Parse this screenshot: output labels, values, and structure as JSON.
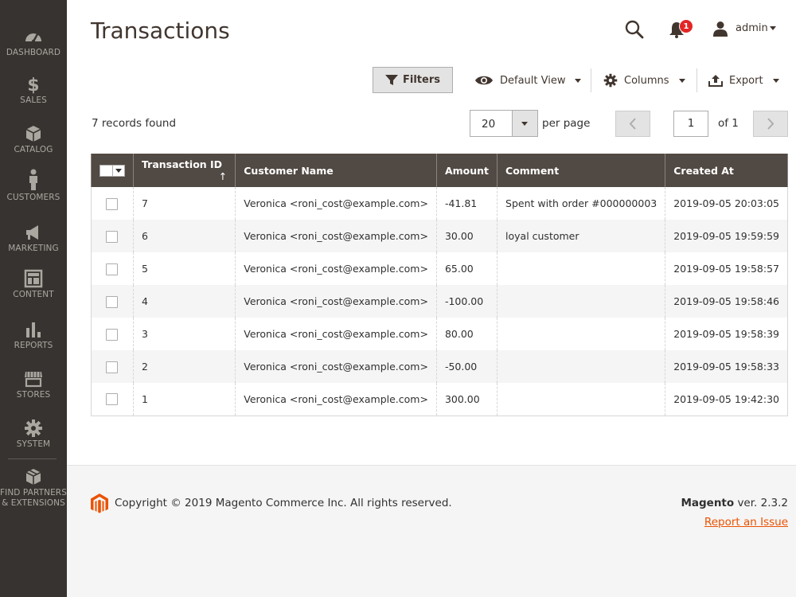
{
  "sidebar": {
    "items": [
      {
        "label": "DASHBOARD"
      },
      {
        "label": "SALES"
      },
      {
        "label": "CATALOG"
      },
      {
        "label": "CUSTOMERS"
      },
      {
        "label": "MARKETING"
      },
      {
        "label": "CONTENT"
      },
      {
        "label": "REPORTS"
      },
      {
        "label": "STORES"
      },
      {
        "label": "SYSTEM"
      },
      {
        "label_line1": "FIND PARTNERS",
        "label_line2": "& EXTENSIONS"
      }
    ]
  },
  "header": {
    "title": "Transactions",
    "notification_count": "1",
    "user": "admin"
  },
  "toolbar": {
    "filters_label": "Filters",
    "view_label": "Default View",
    "columns_label": "Columns",
    "export_label": "Export"
  },
  "grid": {
    "records_found": "7 records found",
    "per_page_value": "20",
    "per_page_label": "per page",
    "page_value": "1",
    "page_of": "of 1",
    "columns": [
      "Transaction ID",
      "Customer Name",
      "Amount",
      "Comment",
      "Created At"
    ],
    "sort_indicator": "↑",
    "rows": [
      {
        "id": "7",
        "customer": "Veronica <roni_cost@example.com>",
        "amount": "-41.81",
        "comment": "Spent with order #000000003",
        "created": "2019-09-05 20:03:05"
      },
      {
        "id": "6",
        "customer": "Veronica <roni_cost@example.com>",
        "amount": "30.00",
        "comment": "loyal customer",
        "created": "2019-09-05 19:59:59"
      },
      {
        "id": "5",
        "customer": "Veronica <roni_cost@example.com>",
        "amount": "65.00",
        "comment": "",
        "created": "2019-09-05 19:58:57"
      },
      {
        "id": "4",
        "customer": "Veronica <roni_cost@example.com>",
        "amount": "-100.00",
        "comment": "",
        "created": "2019-09-05 19:58:46"
      },
      {
        "id": "3",
        "customer": "Veronica <roni_cost@example.com>",
        "amount": "80.00",
        "comment": "",
        "created": "2019-09-05 19:58:39"
      },
      {
        "id": "2",
        "customer": "Veronica <roni_cost@example.com>",
        "amount": "-50.00",
        "comment": "",
        "created": "2019-09-05 19:58:33"
      },
      {
        "id": "1",
        "customer": "Veronica <roni_cost@example.com>",
        "amount": "300.00",
        "comment": "",
        "created": "2019-09-05 19:42:30"
      }
    ]
  },
  "footer": {
    "copyright": "Copyright © 2019 Magento Commerce Inc. All rights reserved.",
    "brand": "Magento",
    "version": " ver. 2.3.2",
    "report_link": "Report an Issue"
  },
  "colors": {
    "sidebar_bg": "#373330",
    "header_row_bg": "#514943",
    "accent": "#eb5202",
    "badge": "#e22626"
  }
}
